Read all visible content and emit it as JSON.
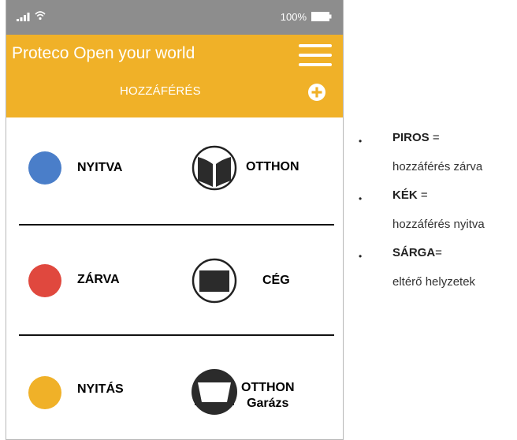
{
  "status_bar": {
    "battery_text": "100%"
  },
  "app_bar": {
    "title": "Proteco Open your world",
    "section_title": "HOZZÁFÉRÉS"
  },
  "rows": [
    {
      "status": {
        "label": "NYITVA",
        "color": "#4a7ec9"
      },
      "place": {
        "label": "OTTHON",
        "sublabel": ""
      }
    },
    {
      "status": {
        "label": "ZÁRVA",
        "color": "#e0483e"
      },
      "place": {
        "label": "CÉG",
        "sublabel": ""
      }
    },
    {
      "status": {
        "label": "NYITÁS",
        "color": "#f0b128"
      },
      "place": {
        "label": "OTTHON",
        "sublabel": "Garázs"
      }
    }
  ],
  "legend": [
    {
      "key": "PIROS",
      "suffix": " =",
      "desc": "hozzáférés zárva"
    },
    {
      "key": "KÉK",
      "suffix": " =",
      "desc": "hozzáférés nyitva"
    },
    {
      "key": "SÁRGA",
      "suffix": "=",
      "desc": "eltérő helyzetek"
    }
  ],
  "colors": {
    "accent": "#f0b128",
    "status_bar": "#8d8d8d"
  }
}
